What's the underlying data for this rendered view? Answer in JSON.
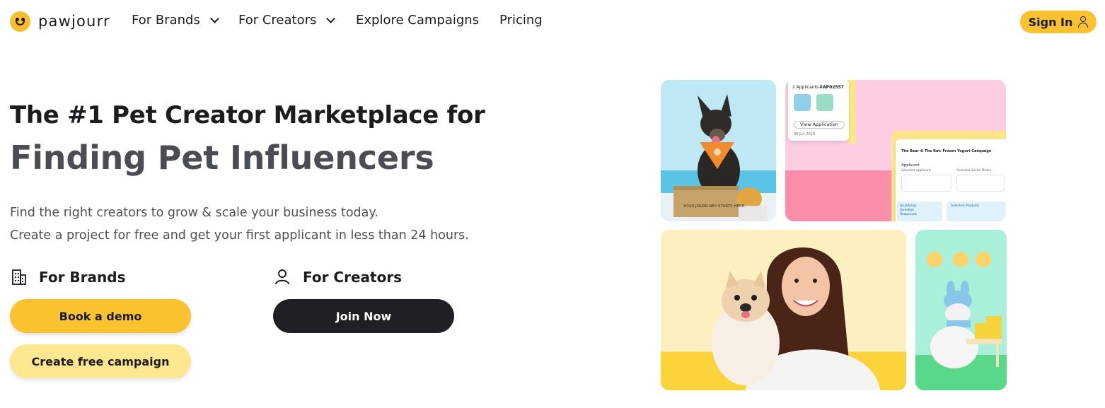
{
  "brand": {
    "name": "pawjourr"
  },
  "nav": {
    "items": [
      {
        "label": "For Brands",
        "dropdown": true
      },
      {
        "label": "For Creators",
        "dropdown": true
      },
      {
        "label": "Explore Campaigns",
        "dropdown": false
      },
      {
        "label": "Pricing",
        "dropdown": false
      }
    ],
    "signin_label": "Sign In"
  },
  "hero": {
    "title_line1": "The #1 Pet Creator Marketplace for",
    "title_line2": "Finding Pet Influencers",
    "subtitle_line1": "Find the right creators to grow & scale your business today.",
    "subtitle_line2": "Create a project for free and get your first applicant in less than 24 hours."
  },
  "brands": {
    "title": "For Brands",
    "primary_button": "Book a demo",
    "secondary_button": "Create free campaign"
  },
  "creators": {
    "title": "For Creators",
    "button": "Join Now"
  },
  "collage": {
    "box_text": "YOUR JOURR-NEY STARTS HERE.",
    "application_card": {
      "count_label": "2 Applicants",
      "id": "#AP02557",
      "view_button": "View Application",
      "date": "06 Jun 2023"
    },
    "campaign_card": {
      "title": "The Bear & The Rat: Frozen Yogurt Campaign",
      "section": "Applicant",
      "selected_applicant_label": "Selected applicant",
      "selected_media_label": "Selected Social Media",
      "qualifying_label": "Qualifying Question Responses",
      "products_label": "Selected Products"
    }
  },
  "colors": {
    "accent_yellow": "#fbc22f",
    "light_yellow": "#fde78f",
    "dark": "#202024",
    "pink": "#fccde3",
    "mint": "#a8f0da"
  }
}
